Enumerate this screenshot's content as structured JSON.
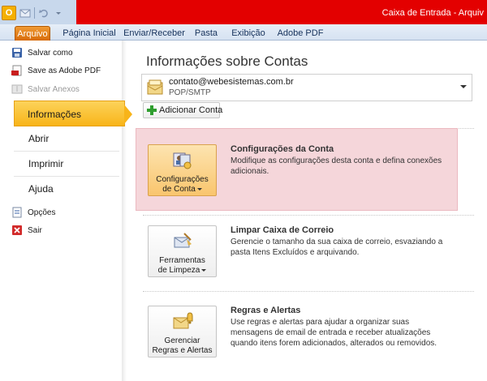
{
  "window": {
    "title": "Caixa de Entrada - Arquiv",
    "app_icon": "O"
  },
  "ribbon": {
    "tabs": [
      {
        "label": "Arquivo"
      },
      {
        "label": "Página Inicial"
      },
      {
        "label": "Enviar/Receber"
      },
      {
        "label": "Pasta"
      },
      {
        "label": "Exibição"
      },
      {
        "label": "Adobe PDF"
      }
    ]
  },
  "nav": {
    "commands": [
      {
        "label": "Salvar como",
        "icon": "save-icon"
      },
      {
        "label": "Save as Adobe PDF",
        "icon": "pdf-icon"
      },
      {
        "label": "Salvar Anexos",
        "icon": "attachment-icon",
        "disabled": true
      }
    ],
    "selected": "Informações",
    "tabs": [
      "Abrir",
      "Imprimir",
      "Ajuda"
    ],
    "bottom": [
      {
        "label": "Opções",
        "icon": "options-icon"
      },
      {
        "label": "Sair",
        "icon": "exit-icon"
      }
    ]
  },
  "main": {
    "title": "Informações sobre Contas",
    "account": {
      "email": "contato@webesistemas.com.br",
      "type": "POP/SMTP"
    },
    "add_account": "Adicionar Conta",
    "sections": [
      {
        "button_line1": "Configurações",
        "button_line2": "de Conta",
        "title": "Configurações da Conta",
        "description": "Modifique as configurações desta conta e defina conexões adicionais."
      },
      {
        "button_line1": "Ferramentas",
        "button_line2": "de Limpeza",
        "title": "Limpar Caixa de Correio",
        "description": "Gerencie o tamanho da sua caixa de correio, esvaziando a pasta Itens Excluídos e arquivando."
      },
      {
        "button_line1": "Gerenciar",
        "button_line2": "Regras e Alertas",
        "title": "Regras e Alertas",
        "description": "Use regras e alertas para ajudar a organizar suas mensagens de email de entrada e receber atualizações quando itens forem adicionados, alterados ou removidos."
      }
    ]
  },
  "colors": {
    "title_bar": "#e30000",
    "file_tab": "#e07a14",
    "selected_nav": "#f8b419",
    "highlight_section": "#f5d6da"
  }
}
